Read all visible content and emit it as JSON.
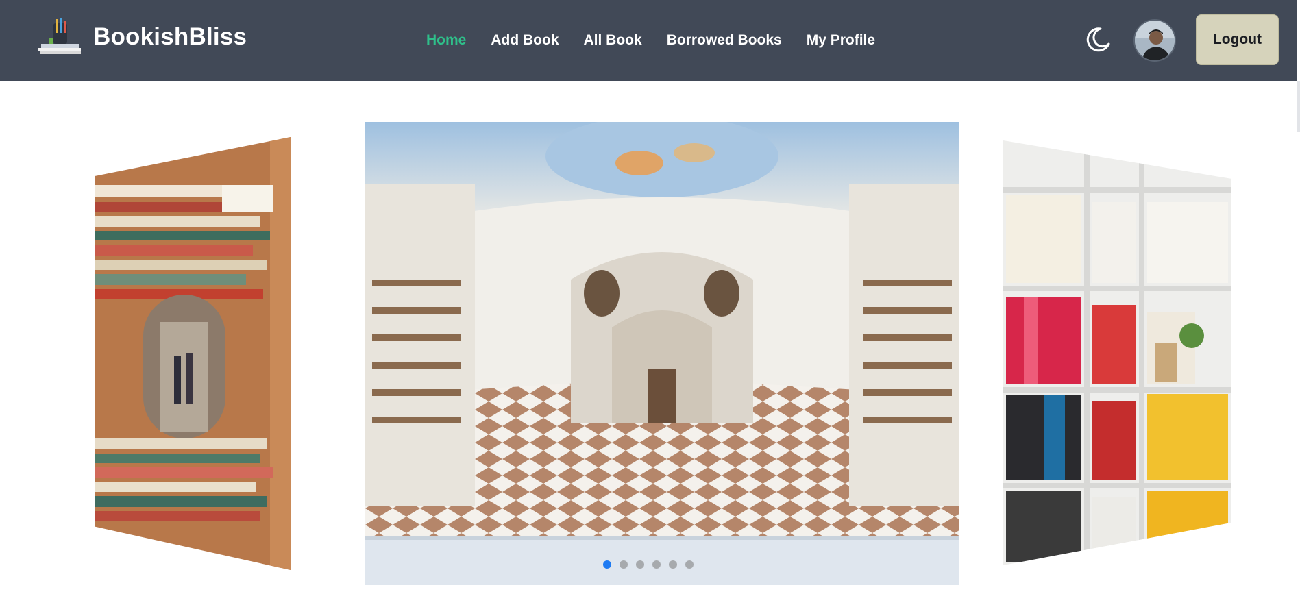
{
  "brand": {
    "name": "BookishBliss",
    "logo_icon": "books-logo-icon"
  },
  "nav": {
    "links": [
      {
        "label": "Home",
        "active": true
      },
      {
        "label": "Add Book",
        "active": false
      },
      {
        "label": "All Book",
        "active": false
      },
      {
        "label": "Borrowed Books",
        "active": false
      },
      {
        "label": "My Profile",
        "active": false
      }
    ],
    "active_color": "#2fbf8a"
  },
  "actions": {
    "theme_toggle_icon": "moon-icon",
    "avatar_icon": "user-avatar",
    "logout_label": "Logout"
  },
  "carousel": {
    "slides": [
      "library-tunnel-image",
      "baroque-library-hall-image",
      "colorful-bookshelf-image"
    ],
    "dot_count": 6,
    "active_dot": 0
  },
  "colors": {
    "navbar": "#414957",
    "logout_bg": "#d6d3bb",
    "dot_active": "#1f7bf2"
  }
}
